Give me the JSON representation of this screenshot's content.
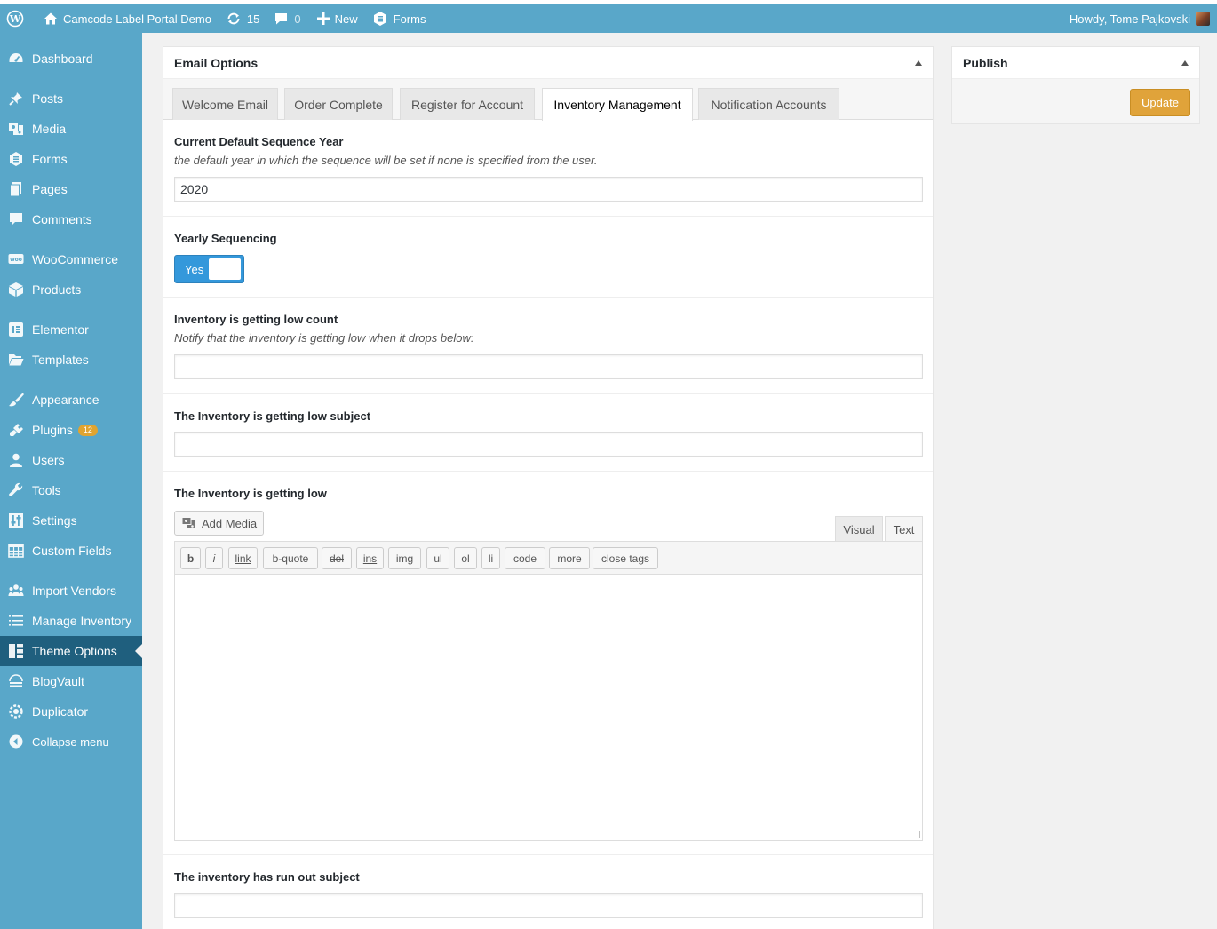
{
  "admin_bar": {
    "site_name": "Camcode Label Portal Demo",
    "updates_count": "15",
    "comments_count": "0",
    "new_label": "New",
    "forms_label": "Forms",
    "greeting": "Howdy, Tome Pajkovski"
  },
  "sidebar": {
    "items": [
      {
        "label": "Dashboard",
        "icon": "dashboard-icon"
      },
      {
        "label": "Posts",
        "icon": "pin-icon"
      },
      {
        "label": "Media",
        "icon": "media-icon"
      },
      {
        "label": "Forms",
        "icon": "forms-icon"
      },
      {
        "label": "Pages",
        "icon": "pages-icon"
      },
      {
        "label": "Comments",
        "icon": "comment-icon"
      },
      {
        "label": "WooCommerce",
        "icon": "woo-icon"
      },
      {
        "label": "Products",
        "icon": "box-icon"
      },
      {
        "label": "Elementor",
        "icon": "elementor-icon"
      },
      {
        "label": "Templates",
        "icon": "folder-icon"
      },
      {
        "label": "Appearance",
        "icon": "brush-icon"
      },
      {
        "label": "Plugins",
        "icon": "plug-icon",
        "badge": "12"
      },
      {
        "label": "Users",
        "icon": "user-icon"
      },
      {
        "label": "Tools",
        "icon": "wrench-icon"
      },
      {
        "label": "Settings",
        "icon": "sliders-icon"
      },
      {
        "label": "Custom Fields",
        "icon": "grid-icon"
      },
      {
        "label": "Import Vendors",
        "icon": "group-icon"
      },
      {
        "label": "Manage Inventory",
        "icon": "list-icon"
      },
      {
        "label": "Theme Options",
        "icon": "layout-icon",
        "current": true
      },
      {
        "label": "BlogVault",
        "icon": "vault-icon"
      },
      {
        "label": "Duplicator",
        "icon": "duplicator-icon"
      }
    ],
    "collapse_label": "Collapse menu"
  },
  "email_options": {
    "title": "Email Options",
    "tabs": [
      {
        "label": "Welcome Email"
      },
      {
        "label": "Order Complete"
      },
      {
        "label": "Register for Account"
      },
      {
        "label": "Inventory Management",
        "active": true
      },
      {
        "label": "Notification Accounts"
      }
    ],
    "fields": {
      "sequence_year": {
        "label": "Current Default Sequence Year",
        "description": "the default year in which the sequence will be set if none is specified from the user.",
        "value": "2020"
      },
      "yearly_sequencing": {
        "label": "Yearly Sequencing",
        "toggle_label": "Yes",
        "enabled": true
      },
      "low_count": {
        "label": "Inventory is getting low count",
        "description": "Notify that the inventory is getting low when it drops below:",
        "value": ""
      },
      "low_subject": {
        "label": "The Inventory is getting low subject",
        "value": ""
      },
      "low_body": {
        "label": "The Inventory is getting low",
        "add_media": "Add Media",
        "tab_visual": "Visual",
        "tab_text": "Text",
        "active_tab": "Text",
        "buttons": [
          "b",
          "i",
          "link",
          "b-quote",
          "del",
          "ins",
          "img",
          "ul",
          "ol",
          "li",
          "code",
          "more",
          "close tags"
        ],
        "content": ""
      },
      "out_subject": {
        "label": "The inventory has run out subject",
        "value": ""
      }
    }
  },
  "publish": {
    "title": "Publish",
    "update_label": "Update"
  },
  "colors": {
    "admin_accent": "#59a7c9",
    "current_menu": "#1f5f7e",
    "toggle_blue": "#3498db",
    "update_button": "#e0a33a",
    "badge": "#e0a430"
  }
}
